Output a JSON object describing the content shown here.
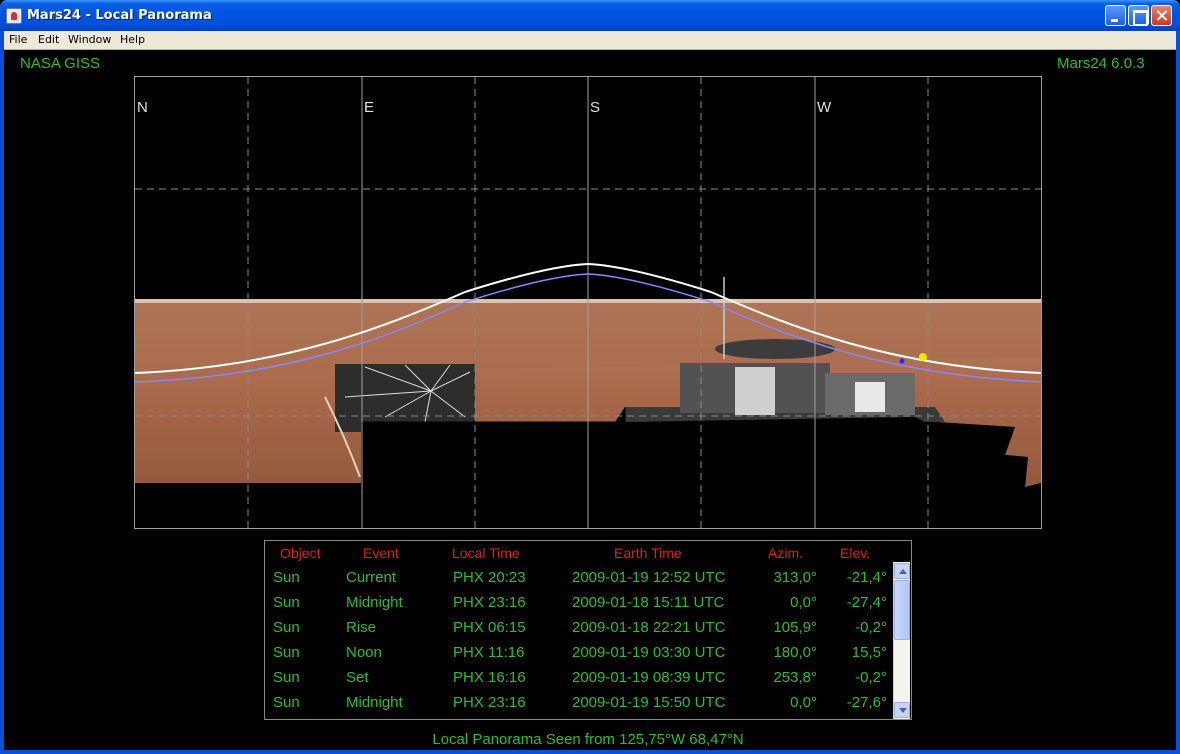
{
  "window": {
    "title": "Mars24 - Local Panorama",
    "icon": "java-coffee-icon",
    "controls": [
      "minimize-icon",
      "maximize-icon",
      "close-icon"
    ]
  },
  "menu": {
    "items": [
      "File",
      "Edit",
      "Window",
      "Help"
    ]
  },
  "header": {
    "left_label": "NASA GISS",
    "right_label": "Mars24 6.0.3"
  },
  "panorama": {
    "compass": [
      "N",
      "E",
      "S",
      "W"
    ],
    "colors": {
      "sun_path": "#ffffff",
      "secondary_path": "#8c86ff",
      "sun_marker": "#ffe000",
      "secondary_marker": "#2a2aff",
      "ground": "#a86a47",
      "grid": "#8a8a8a"
    }
  },
  "table": {
    "headers": {
      "object": "Object",
      "event": "Event",
      "local_time": "Local Time",
      "earth_time": "Earth Time",
      "azim": "Azim.",
      "elev": "Elev."
    },
    "rows": [
      {
        "object": "Sun",
        "event": "Current",
        "local_time": "PHX 20:23",
        "earth_time": "2009-01-19 12:52 UTC",
        "azim": "313,0°",
        "elev": "-21,4°"
      },
      {
        "object": "Sun",
        "event": "Midnight",
        "local_time": "PHX 23:16",
        "earth_time": "2009-01-18 15:11 UTC",
        "azim": "0,0°",
        "elev": "-27,4°"
      },
      {
        "object": "Sun",
        "event": "Rise",
        "local_time": "PHX 06:15",
        "earth_time": "2009-01-18 22:21 UTC",
        "azim": "105,9°",
        "elev": "-0,2°"
      },
      {
        "object": "Sun",
        "event": "Noon",
        "local_time": "PHX 11:16",
        "earth_time": "2009-01-19 03:30 UTC",
        "azim": "180,0°",
        "elev": "15,5°"
      },
      {
        "object": "Sun",
        "event": "Set",
        "local_time": "PHX 16:16",
        "earth_time": "2009-01-19 08:39 UTC",
        "azim": "253,8°",
        "elev": "-0,2°"
      },
      {
        "object": "Sun",
        "event": "Midnight",
        "local_time": "PHX 23:16",
        "earth_time": "2009-01-19 15:50 UTC",
        "azim": "0,0°",
        "elev": "-27,6°"
      }
    ]
  },
  "footer": {
    "text": "Local Panorama Seen from 125,75°W 68,47°N"
  }
}
